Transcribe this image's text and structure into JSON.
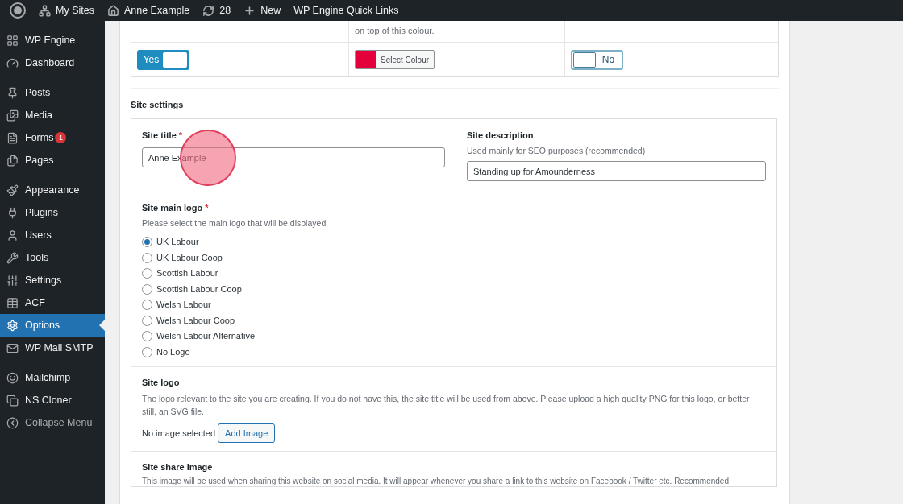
{
  "admin_bar": {
    "items": [
      {
        "kind": "logo"
      },
      {
        "kind": "sites",
        "label": "My Sites"
      },
      {
        "kind": "home",
        "label": "Anne Example"
      },
      {
        "kind": "updates",
        "label": "28"
      },
      {
        "kind": "new",
        "label": "New"
      },
      {
        "kind": "text",
        "label": "WP Engine Quick Links"
      }
    ]
  },
  "sidebar": {
    "groups": [
      [
        {
          "label": "WP Engine",
          "selected": false
        },
        {
          "label": "Dashboard",
          "selected": false
        }
      ],
      [
        {
          "label": "Posts",
          "selected": false
        },
        {
          "label": "Media",
          "selected": false
        },
        {
          "label": "Forms",
          "badge": "1",
          "selected": false
        },
        {
          "label": "Pages",
          "selected": false
        }
      ],
      [
        {
          "label": "Appearance",
          "selected": false
        },
        {
          "label": "Plugins",
          "selected": false
        },
        {
          "label": "Users",
          "selected": false
        },
        {
          "label": "Tools",
          "selected": false
        },
        {
          "label": "Settings",
          "selected": false
        },
        {
          "label": "ACF",
          "selected": false
        },
        {
          "label": "Options",
          "selected": true
        },
        {
          "label": "WP Mail SMTP",
          "selected": false
        }
      ],
      [
        {
          "label": "Mailchimp",
          "selected": false
        },
        {
          "label": "NS Cloner",
          "selected": false
        },
        {
          "label": "Collapse Menu",
          "selected": false,
          "muted": true
        }
      ]
    ]
  },
  "top_table": {
    "note": "on top of this colour.",
    "toggle_1": {
      "label": "Yes",
      "on": true
    },
    "colour": {
      "color": "#e4003b",
      "button": "Select Colour"
    },
    "toggle_2": {
      "label": "No",
      "on": false
    }
  },
  "section_title": "Site settings",
  "site_title": {
    "label": "Site title",
    "required_mark": "*",
    "value": "Anne Example"
  },
  "site_description": {
    "label": "Site description",
    "hint": "Used mainly for SEO purposes (recommended)",
    "value": "Standing up for Amounderness"
  },
  "site_main_logo": {
    "label": "Site main logo",
    "required_mark": "*",
    "hint": "Please select the main logo that will be displayed",
    "options": [
      {
        "label": "UK Labour",
        "selected": true
      },
      {
        "label": "UK Labour Coop",
        "selected": false
      },
      {
        "label": "Scottish Labour",
        "selected": false
      },
      {
        "label": "Scottish Labour Coop",
        "selected": false
      },
      {
        "label": "Welsh Labour",
        "selected": false
      },
      {
        "label": "Welsh Labour Coop",
        "selected": false
      },
      {
        "label": "Welsh Labour Alternative",
        "selected": false
      },
      {
        "label": "No Logo",
        "selected": false
      }
    ]
  },
  "site_logo": {
    "label": "Site logo",
    "hint": "The logo relevant to the site you are creating. If you do not have this, the site title will be used from above. Please upload a high quality PNG for this logo, or better still, an SVG file.",
    "status": "No image selected",
    "button": "Add Image"
  },
  "site_share_image": {
    "label": "Site share image",
    "hint": "This image will be used when sharing this website on social media. It will appear whenever you share a link to this website on Facebook / Twitter etc. Recommended"
  }
}
